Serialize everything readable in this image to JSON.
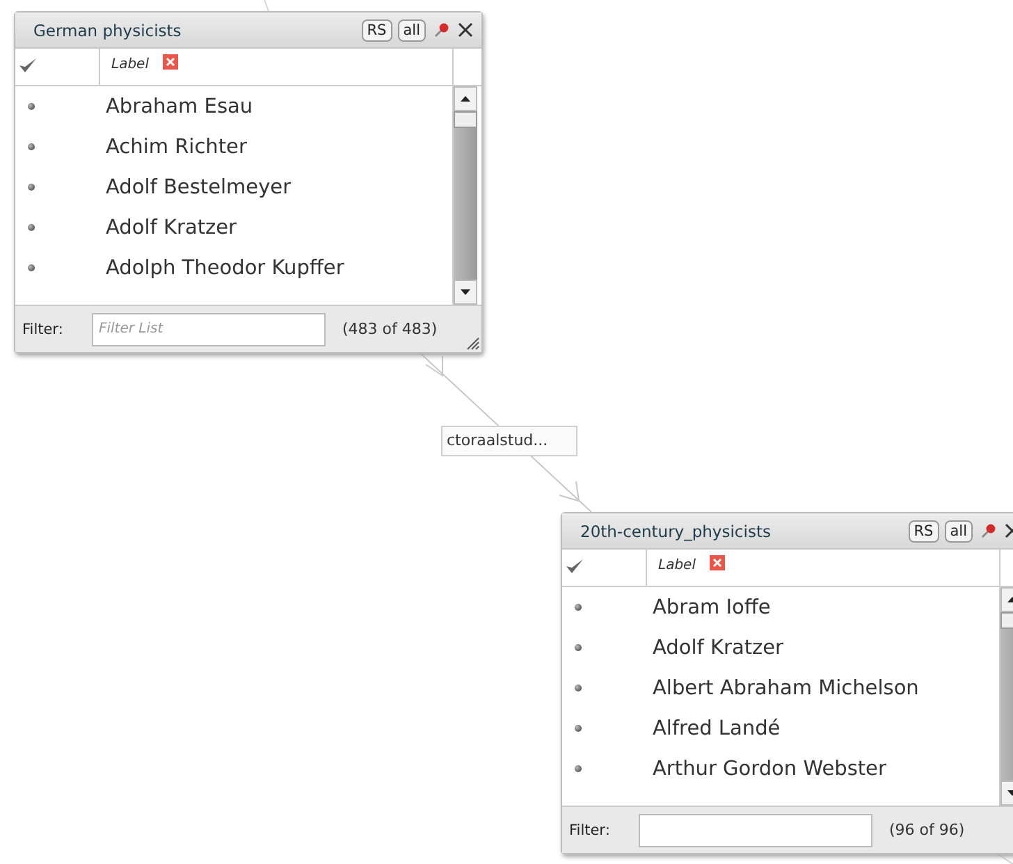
{
  "edge_label": "ctoraalstud...",
  "panels": [
    {
      "title": "German physicists",
      "buttons": [
        "RS",
        "all"
      ],
      "column": "Label",
      "items": [
        "Abraham Esau",
        "Achim Richter",
        "Adolf Bestelmeyer",
        "Adolf Kratzer",
        "Adolph Theodor Kupffer"
      ],
      "filter": {
        "label": "Filter:",
        "placeholder": "Filter List"
      },
      "count": "(483 of 483)"
    },
    {
      "title": "20th-century_physicists",
      "buttons": [
        "RS",
        "all"
      ],
      "column": "Label",
      "items": [
        "Abram Ioffe",
        "Adolf Kratzer",
        "Albert Abraham Michelson",
        "Alfred Landé",
        "Arthur Gordon Webster"
      ],
      "filter": {
        "label": "Filter:"
      },
      "count": "(96 of 96)"
    }
  ]
}
